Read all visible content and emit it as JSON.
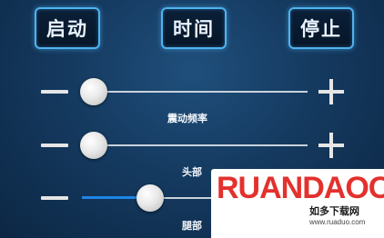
{
  "buttons": {
    "start_label": "启动",
    "time_label": "时间",
    "stop_label": "停止"
  },
  "sliders": [
    {
      "label": "震动频率",
      "value": 0.0
    },
    {
      "label": "头部",
      "value": 0.0
    },
    {
      "label": "腿部",
      "value": 0.3
    }
  ],
  "watermark": {
    "logo_text": "RUANDAOO",
    "tagline": "如多下载网",
    "url": "www.ruaduo.com"
  },
  "colors": {
    "button_border": "#4fb2f0",
    "slider_fill": "#1e86e6",
    "logo_red": "#e3312d"
  }
}
